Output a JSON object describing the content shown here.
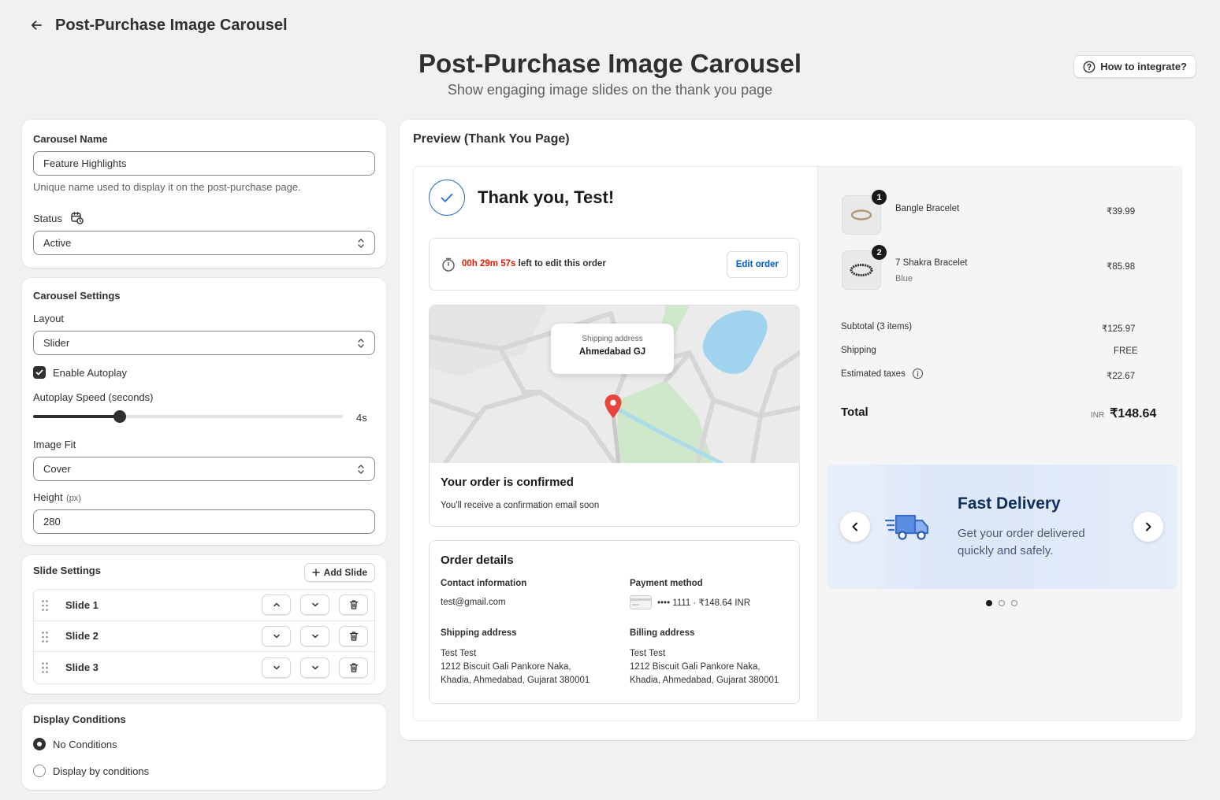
{
  "topbar": {
    "title": "Post-Purchase Image Carousel"
  },
  "hero": {
    "title": "Post-Purchase Image Carousel",
    "subtitle": "Show engaging image slides on the thank you page"
  },
  "how_button": "How to integrate?",
  "basic": {
    "name_label": "Carousel Name",
    "name_value": "Feature Highlights",
    "name_help": "Unique name used to display it on the post-purchase page.",
    "status_label": "Status",
    "status_value": "Active"
  },
  "settings": {
    "title": "Carousel Settings",
    "layout_label": "Layout",
    "layout_value": "Slider",
    "autoplay_label": "Enable Autoplay",
    "autoplay_checked": true,
    "speed_label": "Autoplay Speed (seconds)",
    "speed_value": "4s",
    "speed_fraction": 0.28,
    "fit_label": "Image Fit",
    "fit_value": "Cover",
    "height_label": "Height",
    "height_unit": "(px)",
    "height_value": "280"
  },
  "slides": {
    "title": "Slide Settings",
    "add_label": "Add Slide",
    "items": [
      {
        "name": "Slide 1"
      },
      {
        "name": "Slide 2"
      },
      {
        "name": "Slide 3"
      }
    ]
  },
  "conditions": {
    "title": "Display Conditions",
    "options": [
      {
        "label": "No Conditions",
        "selected": true
      },
      {
        "label": "Display by conditions",
        "selected": false
      }
    ]
  },
  "preview": {
    "title": "Preview (Thank You Page)",
    "thank_you": "Thank you, Test!",
    "timer": "00h 29m 57s",
    "timer_suffix": "left to edit this order",
    "edit_order": "Edit order",
    "map_tooltip_label": "Shipping address",
    "map_tooltip_city": "Ahmedabad GJ",
    "confirmed_title": "Your order is confirmed",
    "confirmed_text": "You'll receive a confirmation email soon",
    "details_title": "Order details",
    "contact_label": "Contact information",
    "contact_value": "test@gmail.com",
    "payment_label": "Payment method",
    "payment_value": "•••• 1111 · ₹148.64 INR",
    "shipping_label": "Shipping address",
    "billing_label": "Billing address",
    "address_name": "Test Test",
    "address_line1": "1212 Biscuit Gali Pankore Naka,",
    "address_line2": "Khadia, Ahmedabad, Gujarat 380001",
    "items": [
      {
        "qty": "1",
        "name": "Bangle Bracelet",
        "variant": "",
        "price": "₹39.99"
      },
      {
        "qty": "2",
        "name": "7 Shakra Bracelet",
        "variant": "Blue",
        "price": "₹85.98"
      }
    ],
    "subtotal_label": "Subtotal (3 items)",
    "subtotal_value": "₹125.97",
    "shipping_cost_label": "Shipping",
    "shipping_cost_value": "FREE",
    "taxes_label": "Estimated taxes",
    "taxes_value": "₹22.67",
    "total_label": "Total",
    "total_currency": "INR",
    "total_value": "₹148.64",
    "carousel": {
      "title": "Fast Delivery",
      "text_line1": "Get your order delivered",
      "text_line2": "quickly and safely.",
      "active_dot": 0,
      "dot_count": 3
    }
  },
  "colors": {
    "timer": "#e51c00",
    "link": "#005bd3",
    "check_circle": "#2c6ecb",
    "carousel_title": "#0f2e5c",
    "pin": "#e8453c"
  }
}
